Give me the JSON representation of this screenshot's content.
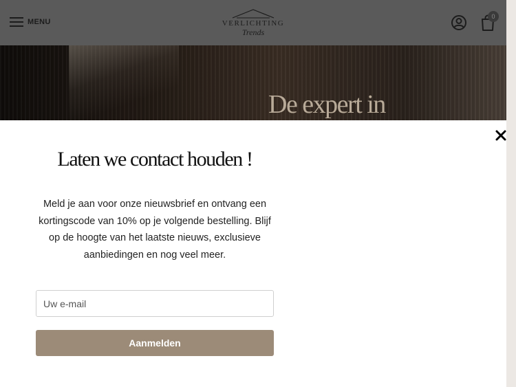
{
  "header": {
    "menu_label": "MENU",
    "logo_top": "VERLICHTING",
    "logo_bottom": "Trends",
    "cart_count": "0"
  },
  "hero": {
    "title": "De expert in"
  },
  "modal": {
    "title": "Laten we contact houden !",
    "description": "Meld je aan voor onze nieuwsbrief en ontvang een kortingscode van 10% op je volgende bestelling. Blijf op de hoogte van het laatste nieuws, exclusieve aanbiedingen en nog veel meer.",
    "email_placeholder": "Uw e-mail",
    "submit_label": "Aanmelden"
  },
  "colors": {
    "header_bg": "#5a5a5a",
    "button_bg": "#9c8b78",
    "side_strip": "#ece8e4"
  },
  "icons": [
    "menu-icon",
    "account-icon",
    "cart-icon",
    "close-icon"
  ]
}
